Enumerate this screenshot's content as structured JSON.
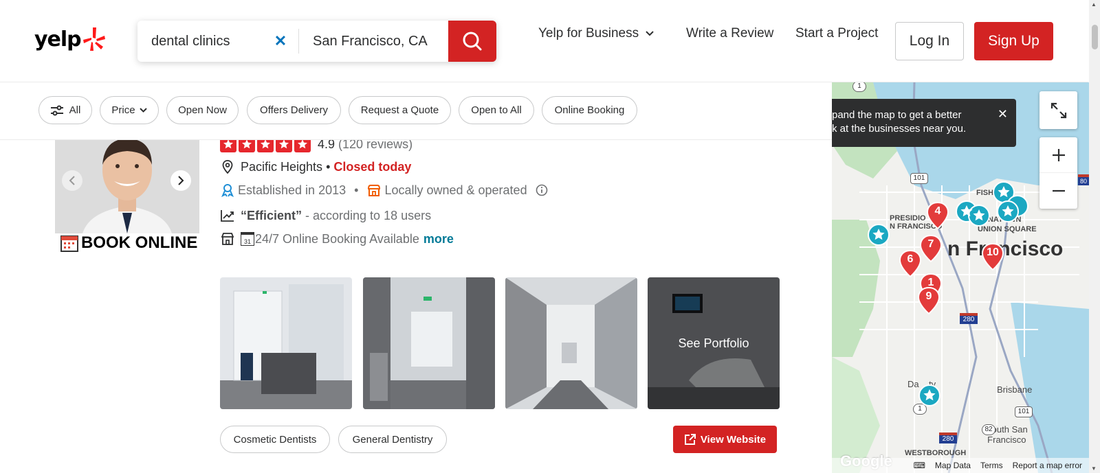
{
  "header": {
    "logo_text": "yelp",
    "search_what": "dental clinics",
    "search_where": "San Francisco, CA",
    "nav": {
      "business": "Yelp for Business",
      "review": "Write a Review",
      "project": "Start a Project"
    },
    "login": "Log In",
    "signup": "Sign Up"
  },
  "filters": [
    "All",
    "Price",
    "Open Now",
    "Offers Delivery",
    "Request a Quote",
    "Open to All",
    "Online Booking"
  ],
  "listing": {
    "rating": "4.9",
    "reviews": "(120 reviews)",
    "star_count": 5,
    "neighborhood": "Pacific Heights",
    "bullet": "•",
    "status": "Closed today",
    "established": "Established in 2013",
    "owned": "Locally owned & operated",
    "highlight_quote": "“Efficient”",
    "highlight_rest": " - according to 18 users",
    "booking_text": "24/7 Online Booking Available",
    "more": "more",
    "book_online": "BOOK ONLINE",
    "calendar_day": "31",
    "see_portfolio": "See Portfolio",
    "tags": [
      "Cosmetic Dentists",
      "General Dentistry"
    ],
    "view_website": "View Website"
  },
  "map": {
    "tip_text": "pand the map to get a better\nk at the businesses near you.",
    "labels": {
      "presidio": "PRESIDIO\nN FRANCISCO",
      "chinatown": "CHINATOWN",
      "union_square": "UNION SQUARE",
      "city": "n Francisco",
      "fish": "FISH",
      "brisbane": "Brisbane",
      "south_sf": "South San\nFrancisco",
      "daly": "Da    ty",
      "westborough": "WESTBOROUGH"
    },
    "highway_shields": [
      "1",
      "101",
      "280",
      "82",
      "280",
      "101",
      "1",
      "80"
    ],
    "red_pins": [
      "4",
      "7",
      "6",
      "10",
      "1",
      "9"
    ],
    "footer": {
      "google": "Google",
      "map_data": "Map Data",
      "terms": "Terms",
      "report": "Report a map error"
    }
  },
  "colors": {
    "brand_red": "#d32323",
    "link_teal": "#027a97",
    "clear_blue": "#0073bb",
    "teal_pin": "#1ba8c2"
  }
}
